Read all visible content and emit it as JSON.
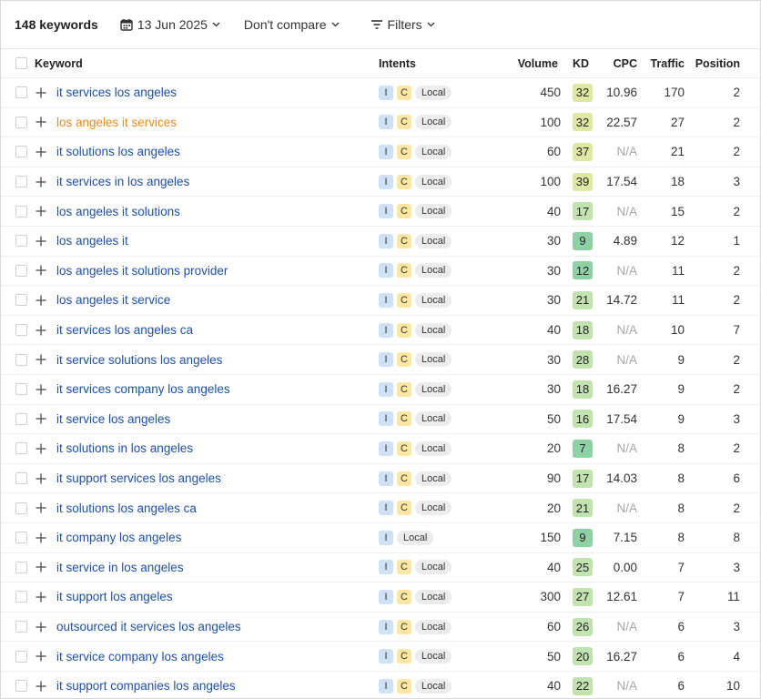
{
  "toolbar": {
    "keyword_count": "148 keywords",
    "date_label": "13 Jun 2025",
    "compare_label": "Don't compare",
    "filters_label": "Filters"
  },
  "table": {
    "headers": {
      "keyword": "Keyword",
      "intents": "Intents",
      "volume": "Volume",
      "kd": "KD",
      "cpc": "CPC",
      "traffic": "Traffic",
      "position": "Position"
    },
    "rows": [
      {
        "keyword": "it services los angeles",
        "intents": [
          "I",
          "C"
        ],
        "local": "Local",
        "volume": "450",
        "kd": "32",
        "cpc": "10.96",
        "traffic": "170",
        "position": "2"
      },
      {
        "keyword": "los angeles it services",
        "visited": true,
        "intents": [
          "I",
          "C"
        ],
        "local": "Local",
        "volume": "100",
        "kd": "32",
        "cpc": "22.57",
        "traffic": "27",
        "position": "2"
      },
      {
        "keyword": "it solutions los angeles",
        "intents": [
          "I",
          "C"
        ],
        "local": "Local",
        "volume": "60",
        "kd": "37",
        "cpc": "N/A",
        "traffic": "21",
        "position": "2"
      },
      {
        "keyword": "it services in los angeles",
        "intents": [
          "I",
          "C"
        ],
        "local": "Local",
        "volume": "100",
        "kd": "39",
        "cpc": "17.54",
        "traffic": "18",
        "position": "3"
      },
      {
        "keyword": "los angeles it solutions",
        "intents": [
          "I",
          "C"
        ],
        "local": "Local",
        "volume": "40",
        "kd": "17",
        "cpc": "N/A",
        "traffic": "15",
        "position": "2"
      },
      {
        "keyword": "los angeles it",
        "intents": [
          "I",
          "C"
        ],
        "local": "Local",
        "volume": "30",
        "kd": "9",
        "cpc": "4.89",
        "traffic": "12",
        "position": "1"
      },
      {
        "keyword": "los angeles it solutions provider",
        "intents": [
          "I",
          "C"
        ],
        "local": "Local",
        "volume": "30",
        "kd": "12",
        "cpc": "N/A",
        "traffic": "11",
        "position": "2"
      },
      {
        "keyword": "los angeles it service",
        "intents": [
          "I",
          "C"
        ],
        "local": "Local",
        "volume": "30",
        "kd": "21",
        "cpc": "14.72",
        "traffic": "11",
        "position": "2"
      },
      {
        "keyword": "it services los angeles ca",
        "intents": [
          "I",
          "C"
        ],
        "local": "Local",
        "volume": "40",
        "kd": "18",
        "cpc": "N/A",
        "traffic": "10",
        "position": "7"
      },
      {
        "keyword": "it service solutions los angeles",
        "intents": [
          "I",
          "C"
        ],
        "local": "Local",
        "volume": "30",
        "kd": "28",
        "cpc": "N/A",
        "traffic": "9",
        "position": "2"
      },
      {
        "keyword": "it services company los angeles",
        "intents": [
          "I",
          "C"
        ],
        "local": "Local",
        "volume": "30",
        "kd": "18",
        "cpc": "16.27",
        "traffic": "9",
        "position": "2"
      },
      {
        "keyword": "it service los angeles",
        "intents": [
          "I",
          "C"
        ],
        "local": "Local",
        "volume": "50",
        "kd": "16",
        "cpc": "17.54",
        "traffic": "9",
        "position": "3"
      },
      {
        "keyword": "it solutions in los angeles",
        "intents": [
          "I",
          "C"
        ],
        "local": "Local",
        "volume": "20",
        "kd": "7",
        "cpc": "N/A",
        "traffic": "8",
        "position": "2"
      },
      {
        "keyword": "it support services los angeles",
        "intents": [
          "I",
          "C"
        ],
        "local": "Local",
        "volume": "90",
        "kd": "17",
        "cpc": "14.03",
        "traffic": "8",
        "position": "6"
      },
      {
        "keyword": "it solutions los angeles ca",
        "intents": [
          "I",
          "C"
        ],
        "local": "Local",
        "volume": "20",
        "kd": "21",
        "cpc": "N/A",
        "traffic": "8",
        "position": "2"
      },
      {
        "keyword": "it company los angeles",
        "intents": [
          "I"
        ],
        "local": "Local",
        "volume": "150",
        "kd": "9",
        "cpc": "7.15",
        "traffic": "8",
        "position": "8"
      },
      {
        "keyword": "it service in los angeles",
        "intents": [
          "I",
          "C"
        ],
        "local": "Local",
        "volume": "40",
        "kd": "25",
        "cpc": "0.00",
        "traffic": "7",
        "position": "3"
      },
      {
        "keyword": "it support los angeles",
        "intents": [
          "I",
          "C"
        ],
        "local": "Local",
        "volume": "300",
        "kd": "27",
        "cpc": "12.61",
        "traffic": "7",
        "position": "11"
      },
      {
        "keyword": "outsourced it services los angeles",
        "intents": [
          "I",
          "C"
        ],
        "local": "Local",
        "volume": "60",
        "kd": "26",
        "cpc": "N/A",
        "traffic": "6",
        "position": "3"
      },
      {
        "keyword": "it service company los angeles",
        "intents": [
          "I",
          "C"
        ],
        "local": "Local",
        "volume": "50",
        "kd": "20",
        "cpc": "16.27",
        "traffic": "6",
        "position": "4"
      },
      {
        "keyword": "it support companies los angeles",
        "intents": [
          "I",
          "C"
        ],
        "local": "Local",
        "volume": "40",
        "kd": "22",
        "cpc": "N/A",
        "traffic": "6",
        "position": "10"
      }
    ]
  },
  "colors": {
    "link": "#1d4fa8",
    "visited_link": "#ef8a1a",
    "intent_i": "#cfe1f7",
    "intent_c": "#fbe7a1",
    "kd_very_easy": "#8fd0a5",
    "kd_easy": "#c2e3b0",
    "kd_possible": "#dfe7a2"
  }
}
